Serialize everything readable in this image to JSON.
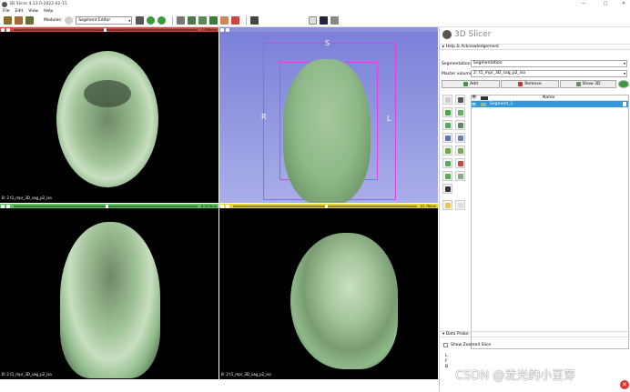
{
  "window": {
    "title": "3D Slicer 4.13.0-2022-02-15",
    "min": "—",
    "max": "□",
    "close": "✕"
  },
  "menu": [
    "File",
    "Edit",
    "View",
    "Help"
  ],
  "toolbar": {
    "modules_label": "Modules:",
    "module_selected": "Segment Editor"
  },
  "views": {
    "red": {
      "offset": "-7.000mm",
      "caption": "B: 2 t1_mpr_3D_sag_p2_iso",
      "color": "#d64545"
    },
    "yellow": {
      "offset": "-51.76mm",
      "caption": "B: 2 t1_mpr_3D_sag_p2_iso",
      "color": "#e6d23a"
    },
    "green": {
      "offset": "-8.517mm",
      "caption": "B: 2 t1_mpr_3D_sag_p2_iso",
      "color": "#5fbf5f"
    },
    "threeD": {
      "top": "S",
      "left": "R",
      "right": "L"
    }
  },
  "panel": {
    "logo": "3D Slicer",
    "help_section": "Help & Acknowledgement",
    "segmentation_label": "Segmentation:",
    "segmentation_value": "Segmentation",
    "master_volume_label": "Master volume:",
    "master_volume_value": "2: t1_mpr_3D_sag_p2_iso",
    "add_label": "Add",
    "remove_label": "Remove",
    "show3d_label": "Show 3D",
    "table_name_header": "Name",
    "segment_name": "Segment_1",
    "data_probe": "Data Probe",
    "show_zoomed_slice": "Show Zoomed Slice",
    "probe_lines": [
      "L",
      "F",
      "B"
    ]
  },
  "overlay": {
    "watermark": "CSDN @发光的小豆芽",
    "close": "✕"
  },
  "colors": {
    "segment_green": "#8fb98a",
    "view3d_bg": "#8a8fe0",
    "roi_box": "#e040e0",
    "selection": "#3399dd"
  }
}
